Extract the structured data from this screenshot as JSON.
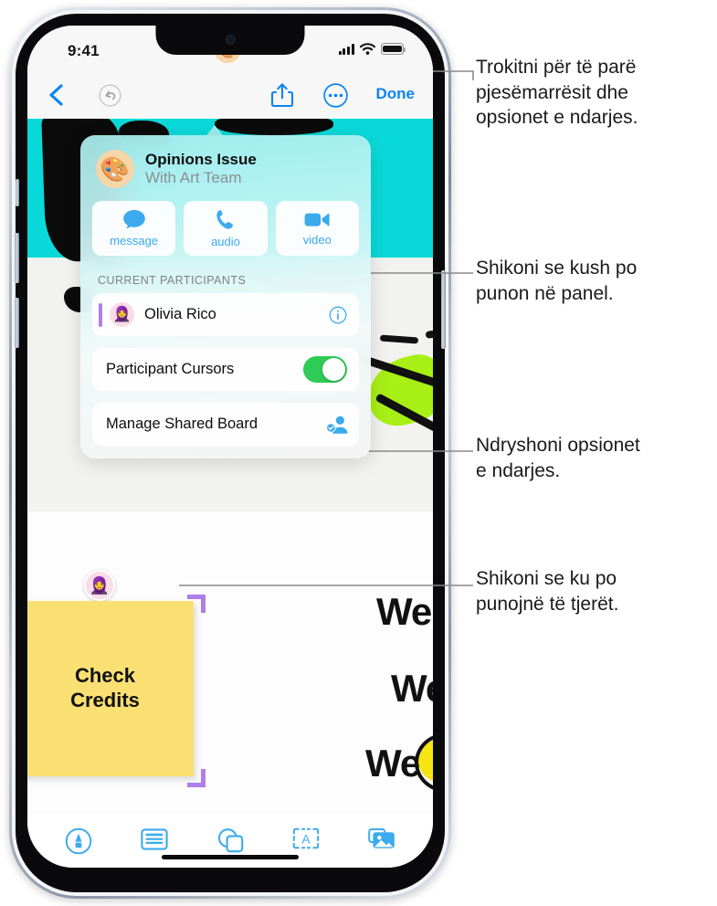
{
  "statusbar": {
    "time": "9:41",
    "cellular_icon": "signal-bars-icon",
    "wifi_icon": "wifi-icon",
    "battery_icon": "battery-icon"
  },
  "navbar": {
    "back_icon": "chevron-left-icon",
    "undo_icon": "undo-icon",
    "avatar_icon": "palette-avatar",
    "avatar_glyph": "🎨",
    "share_icon": "share-icon",
    "more_icon": "more-ellipsis-icon",
    "done_label": "Done"
  },
  "popover": {
    "title": "Opinions Issue",
    "subtitle": "With Art Team",
    "avatar_glyph": "🎨",
    "actions": [
      {
        "name": "message",
        "label": "message",
        "icon": "message-bubble-icon"
      },
      {
        "name": "audio",
        "label": "audio",
        "icon": "phone-icon"
      },
      {
        "name": "video",
        "label": "video",
        "icon": "video-camera-icon"
      }
    ],
    "section_header": "CURRENT PARTICIPANTS",
    "participants": [
      {
        "name": "Olivia Rico",
        "avatar_glyph": "🧕",
        "info_icon": "info-circle-icon",
        "accent_color": "#b07ee8"
      }
    ],
    "toggle_row": {
      "label": "Participant Cursors",
      "state": "on",
      "on_color": "#2ecc57"
    },
    "manage_row": {
      "label": "Manage Shared Board",
      "icon": "shared-person-check-icon"
    }
  },
  "canvas": {
    "sticky_note": {
      "text": "Check\nCredits",
      "color": "#fae073",
      "selected": true,
      "handle_color": "#b07ee8"
    },
    "cursor_avatar_glyph": "🧕",
    "ink_texts": [
      "We",
      "We",
      "We"
    ],
    "colors": {
      "cyan": "#0ad9d9",
      "green_highlight": "#a8ef15",
      "yellow_highlight": "#f5e513",
      "ink": "#111111"
    }
  },
  "toolbar": {
    "tools": [
      {
        "name": "pen-tool",
        "icon": "pen-circle-icon"
      },
      {
        "name": "note-tool",
        "icon": "note-lines-icon"
      },
      {
        "name": "shape-tool",
        "icon": "shapes-icon"
      },
      {
        "name": "text-tool",
        "icon": "text-box-icon"
      },
      {
        "name": "media-tool",
        "icon": "photos-icon"
      }
    ]
  },
  "callouts": [
    {
      "id": "callout-tap-participants",
      "text": "Trokitni për të parë\npjesëmarrësit dhe\nopsionet e ndarjes."
    },
    {
      "id": "callout-see-who",
      "text": "Shikoni se kush po\npunon në panel."
    },
    {
      "id": "callout-change-sharing",
      "text": "Ndryshoni opsionet\ne ndarjes."
    },
    {
      "id": "callout-see-where",
      "text": "Shikoni se ku po\npunojnë të tjerët."
    }
  ]
}
